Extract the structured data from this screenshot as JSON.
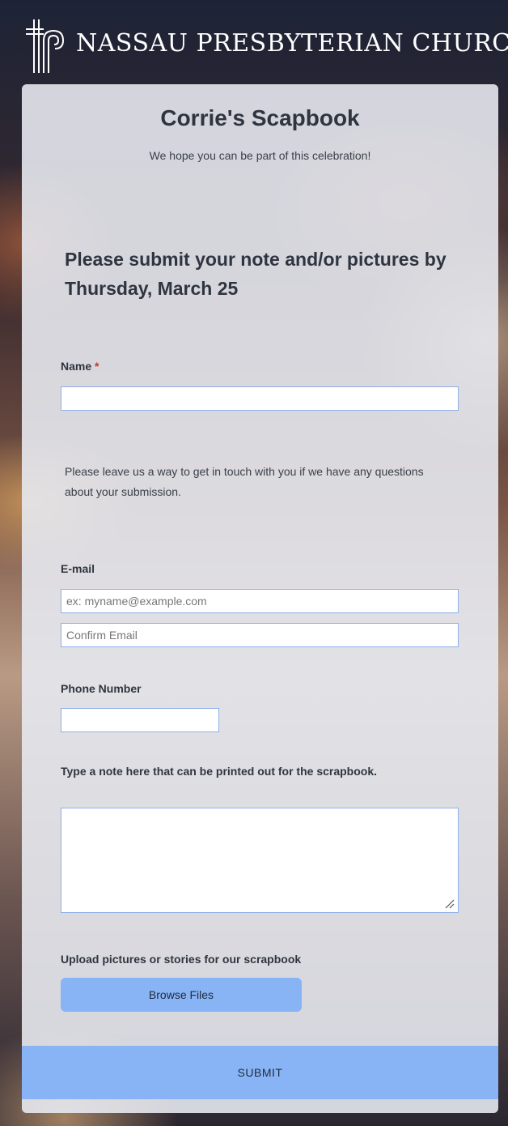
{
  "header": {
    "church_name": "NASSAU PRESBYTERIAN CHURCH"
  },
  "form": {
    "title": "Corrie's Scapbook",
    "subtitle": "We hope you can be part of this celebration!",
    "deadline": "Please submit your note and/or pictures by Thursday, March 25",
    "name_label": "Name",
    "name_required_mark": "*",
    "name_value": "",
    "contact_info": "Please leave us a way to get in touch with you if we have any questions about your submission.",
    "email_label": "E-mail",
    "email_placeholder": "ex: myname@example.com",
    "confirm_email_placeholder": "Confirm Email",
    "phone_label": "Phone Number",
    "phone_value": "",
    "note_label": "Type a note here that can be printed out for the scrapbook.",
    "note_value": "",
    "upload_label": "Upload pictures or stories for our scrapbook",
    "browse_button": "Browse Files",
    "submit_button": "SUBMIT"
  },
  "colors": {
    "accent": "#88b4f5",
    "required": "#c0392b",
    "input_border": "#8fb0e8"
  }
}
